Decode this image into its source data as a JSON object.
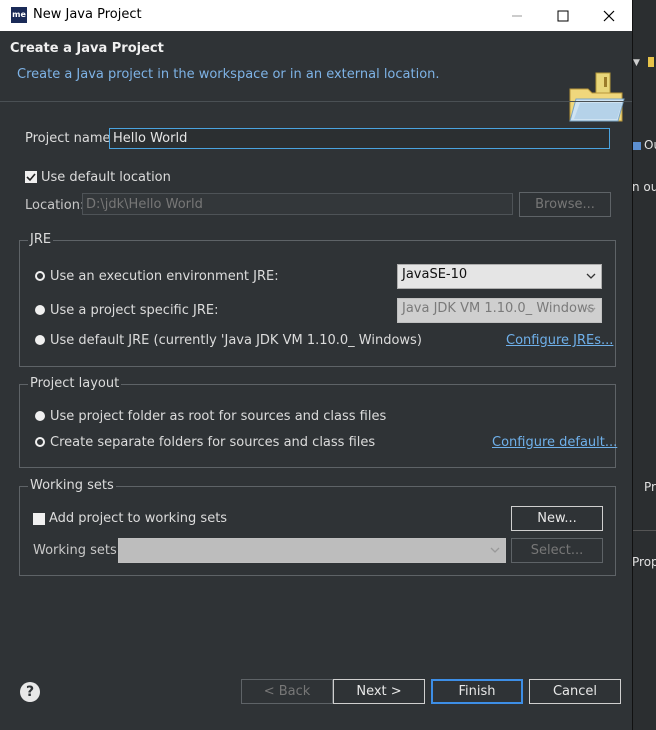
{
  "window": {
    "title": "New Java Project",
    "icon_text": "me"
  },
  "header": {
    "title": "Create a Java Project",
    "subtitle": "Create a Java project in the workspace or in an external location."
  },
  "project_name": {
    "label": "Project name:",
    "value": "Hello World"
  },
  "location": {
    "use_default_label": "Use default location",
    "use_default_checked": true,
    "label": "Location:",
    "value": "D:\\jdk\\Hello World",
    "browse_label": "Browse..."
  },
  "jre": {
    "group_title": "JRE",
    "option_exec_env": "Use an execution environment JRE:",
    "exec_env_value": "JavaSE-10",
    "option_project_specific": "Use a project specific JRE:",
    "project_specific_value": "Java JDK VM 1.10.0_ Windows",
    "option_default": "Use default JRE (currently 'Java JDK VM 1.10.0_ Windows)",
    "configure_link": "Configure JREs...",
    "selected": "exec_env"
  },
  "layout": {
    "group_title": "Project layout",
    "option_root": "Use project folder as root for sources and class files",
    "option_separate": "Create separate folders for sources and class files",
    "configure_link": "Configure default...",
    "selected": "separate"
  },
  "working_sets": {
    "group_title": "Working sets",
    "add_label": "Add project to working sets",
    "add_checked": false,
    "new_label": "New...",
    "sets_label": "Working sets:",
    "select_label": "Select..."
  },
  "footer": {
    "back": "< Back",
    "next": "Next >",
    "finish": "Finish",
    "cancel": "Cancel"
  },
  "background": {
    "text1": "Ou",
    "text2": "n out",
    "text3": "Pr",
    "text4": "Prop"
  },
  "colors": {
    "link": "#6fb0ea",
    "focus": "#4aa3df",
    "dialog_bg": "#2f3336",
    "default_button_border": "#3d8ee6"
  }
}
